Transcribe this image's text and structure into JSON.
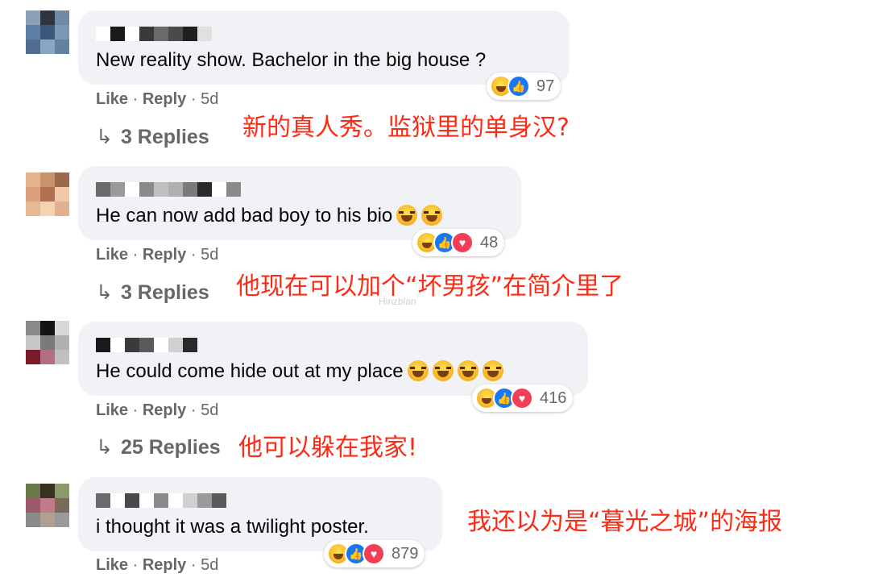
{
  "comments": [
    {
      "name_redacted": true,
      "text": "New reality show. Bachelor in the big house ?",
      "emojis": [],
      "reactions": [
        "haha-icon",
        "like-icon"
      ],
      "count": "97",
      "like": "Like",
      "reply": "Reply",
      "sep": "·",
      "time": "5d",
      "replies": "3 Replies",
      "translation": "新的真人秀。监狱里的单身汉?"
    },
    {
      "name_redacted": true,
      "text": "He can now add bad boy to his bio",
      "emojis": [
        "joy-emoji",
        "joy-emoji"
      ],
      "reactions": [
        "haha-icon",
        "like-icon",
        "love-icon"
      ],
      "count": "48",
      "like": "Like",
      "reply": "Reply",
      "sep": "·",
      "time": "5d",
      "replies": "3 Replies",
      "translation": "他现在可以加个“坏男孩”在简介里了"
    },
    {
      "name_redacted": true,
      "text": "He could come hide out at my place",
      "emojis": [
        "joy-emoji",
        "joy-emoji",
        "joy-emoji",
        "joy-emoji"
      ],
      "reactions": [
        "haha-icon",
        "like-icon",
        "love-icon"
      ],
      "count": "416",
      "like": "Like",
      "reply": "Reply",
      "sep": "·",
      "time": "5d",
      "replies": "25 Replies",
      "translation": "他可以躲在我家!"
    },
    {
      "name_redacted": true,
      "text": "i thought it was a twilight poster.",
      "emojis": [],
      "reactions": [
        "haha-icon",
        "like-icon",
        "love-icon"
      ],
      "count": "879",
      "like": "Like",
      "reply": "Reply",
      "sep": "·",
      "time": "5d",
      "replies": "",
      "translation": "我还以为是“暮光之城”的海报"
    }
  ],
  "watermark": "Hinzblan",
  "colors": {
    "bubble": "#f0f2f5",
    "secondary_text": "#65676b",
    "translation": "#ff2a16",
    "like_blue": "#1877f2",
    "love_red": "#f33e58"
  }
}
